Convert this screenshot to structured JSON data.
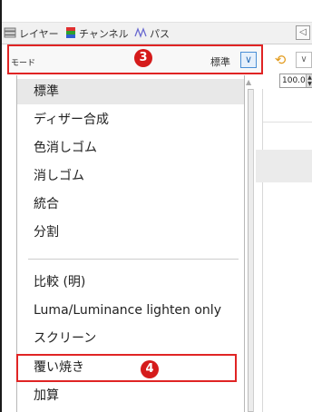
{
  "tabs": [
    {
      "label": "レイヤー",
      "icon": "layers-icon"
    },
    {
      "label": "チャンネル",
      "icon": "channels-icon"
    },
    {
      "label": "パス",
      "icon": "paths-icon"
    }
  ],
  "mode": {
    "label": "モード",
    "value": "標準"
  },
  "opacity": {
    "value": "100.0"
  },
  "callouts": {
    "mode_callout": "3",
    "item_callout": "4"
  },
  "menu": {
    "group1": [
      "標準",
      "ディザー合成",
      "色消しゴム",
      "消しゴム",
      "統合",
      "分割"
    ],
    "group2": [
      "比較 (明)",
      "Luma/Luminance lighten only",
      "スクリーン",
      "覆い焼き",
      "加算"
    ],
    "selected_item": "標準",
    "highlighted_item": "覆い焼き"
  },
  "colors": {
    "highlight": "#e02424",
    "badge": "#d51b1b",
    "accent": "#4a8fd6"
  }
}
